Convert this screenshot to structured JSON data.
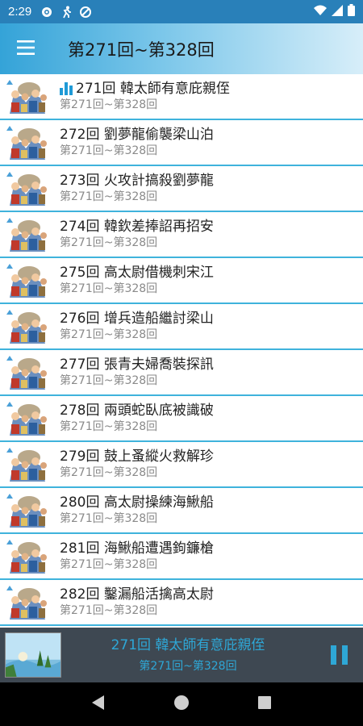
{
  "status_bar": {
    "time": "2:29"
  },
  "app_bar": {
    "title": "第271回~第328回"
  },
  "episodes": [
    {
      "title": "271回 韓太師有意庇親侄",
      "subtitle": "第271回~第328回",
      "playing": true
    },
    {
      "title": "272回 劉夢龍偷襲梁山泊",
      "subtitle": "第271回~第328回",
      "playing": false
    },
    {
      "title": "273回 火攻計搞殺劉夢龍",
      "subtitle": "第271回~第328回",
      "playing": false
    },
    {
      "title": "274回 韓欽差捧詔再招安",
      "subtitle": "第271回~第328回",
      "playing": false
    },
    {
      "title": "275回 高太尉借機刺宋江",
      "subtitle": "第271回~第328回",
      "playing": false
    },
    {
      "title": "276回 增兵造船繼討梁山",
      "subtitle": "第271回~第328回",
      "playing": false
    },
    {
      "title": "277回 張青夫婦喬裝探訊",
      "subtitle": "第271回~第328回",
      "playing": false
    },
    {
      "title": "278回 兩頭蛇臥底被識破",
      "subtitle": "第271回~第328回",
      "playing": false
    },
    {
      "title": "279回 鼓上蚤縱火救解珍",
      "subtitle": "第271回~第328回",
      "playing": false
    },
    {
      "title": "280回 高太尉操練海鰍船",
      "subtitle": "第271回~第328回",
      "playing": false
    },
    {
      "title": "281回 海鰍船遭遇鉤鐮槍",
      "subtitle": "第271回~第328回",
      "playing": false
    },
    {
      "title": "282回 鑿漏船活擒高太尉",
      "subtitle": "第271回~第328回",
      "playing": false
    }
  ],
  "player": {
    "title": "271回 韓太師有意庇親侄",
    "subtitle": "第271回~第328回"
  },
  "colors": {
    "accent": "#2ea7d6",
    "app_bar_start": "#34a3d8",
    "divider": "#3fb3dc",
    "player_bg": "#3e4852"
  }
}
